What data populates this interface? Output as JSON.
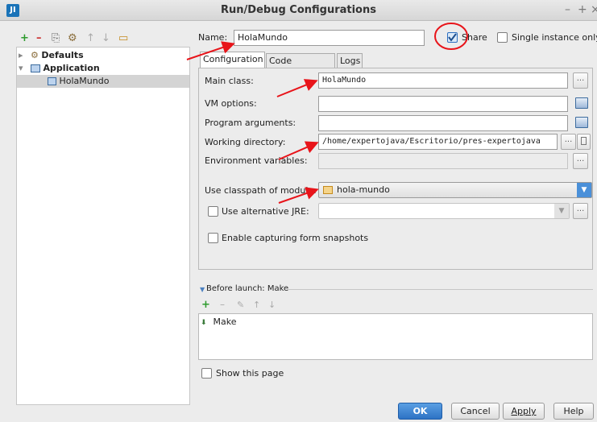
{
  "window": {
    "title": "Run/Debug Configurations",
    "logo": "JI",
    "minimize": "–",
    "maximize": "+",
    "close": "×"
  },
  "tree": {
    "toolbar": {
      "add": "+",
      "remove": "–",
      "copy": "⎘",
      "edit": "⚙",
      "up": "↑",
      "down": "↓",
      "folder": "▭"
    },
    "items": [
      {
        "label": "Defaults",
        "expander": "▸",
        "icon": "wrench-icon"
      },
      {
        "label": "Application",
        "expander": "▾",
        "icon": "application-icon"
      },
      {
        "label": "HolaMundo",
        "icon": "class-icon"
      }
    ]
  },
  "name_row": {
    "label": "Name:",
    "value": "HolaMundo",
    "share_label": "Share",
    "share_checked": true,
    "single_instance_label": "Single instance only",
    "single_instance_checked": false
  },
  "tabs": [
    {
      "label": "Configuration",
      "active": true
    },
    {
      "label": "Code Coverage",
      "active": false
    },
    {
      "label": "Logs",
      "active": false
    }
  ],
  "config": {
    "main_class": {
      "label": "Main class:",
      "value": "HolaMundo"
    },
    "vm_options": {
      "label": "VM options:",
      "value": ""
    },
    "program_arguments": {
      "label": "Program arguments:",
      "value": ""
    },
    "working_directory": {
      "label": "Working directory:",
      "value": "/home/expertojava/Escritorio/pres-expertojava"
    },
    "environment_variables": {
      "label": "Environment variables:",
      "value": ""
    },
    "classpath_module": {
      "label": "Use classpath of module:",
      "value": "hola-mundo"
    },
    "alternative_jre": {
      "label": "Use alternative JRE:",
      "checked": false,
      "value": ""
    },
    "capture_snapshots": {
      "label": "Enable capturing form snapshots",
      "checked": false
    },
    "browse": "..."
  },
  "before_launch": {
    "header": "Before launch: Make",
    "add": "+",
    "remove": "–",
    "edit": "✎",
    "up": "↑",
    "down": "↓",
    "items": [
      {
        "label": "Make"
      }
    ]
  },
  "show_page": {
    "label": "Show this page",
    "checked": false
  },
  "buttons": {
    "ok": "OK",
    "cancel": "Cancel",
    "apply": "Apply",
    "help": "Help"
  },
  "colors": {
    "accent": "#2d72c4",
    "annotation_red": "#e8141a",
    "tree_selection": "#d4d4d4"
  }
}
